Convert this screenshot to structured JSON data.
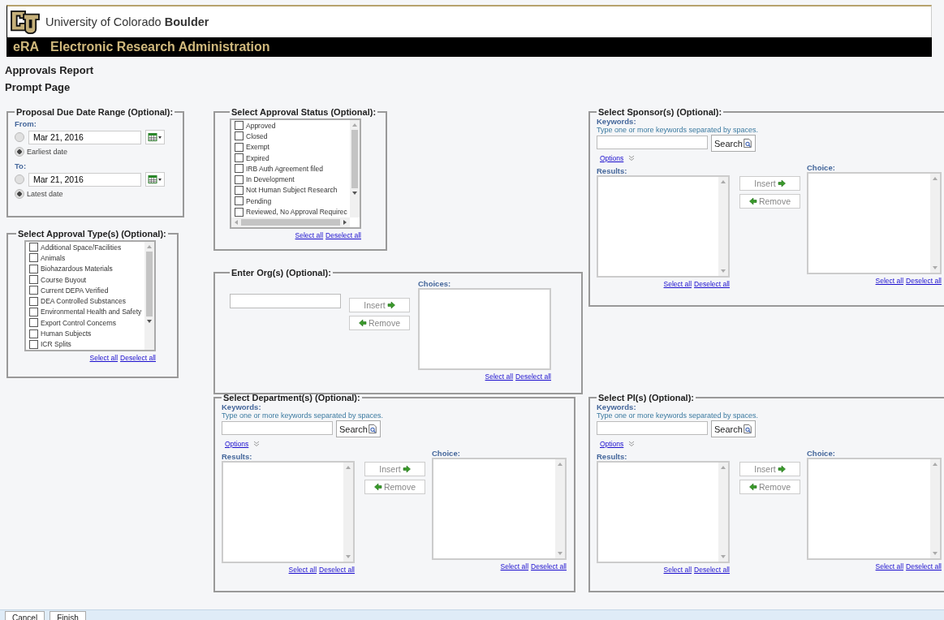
{
  "header": {
    "university": "University of Colorado **Boulder**",
    "app_abbrev": "eRA",
    "app_name": "Electronic Research Administration"
  },
  "page_titles": [
    "Approvals Report",
    "Prompt Page"
  ],
  "date_range": {
    "title": "Proposal Due Date Range (Optional):",
    "groups": [
      {
        "label": "From:",
        "options": [
          {
            "kind": "date",
            "value": "Mar 21, 2016",
            "selected": false
          },
          {
            "kind": "label",
            "label": "Earliest date",
            "selected": true
          }
        ]
      },
      {
        "label": "To:",
        "options": [
          {
            "kind": "date",
            "value": "Mar 21, 2016",
            "selected": false
          },
          {
            "kind": "label",
            "label": "Latest date",
            "selected": true
          }
        ]
      }
    ]
  },
  "approval_types": {
    "title": "Select Approval Type(s) (Optional):",
    "items": [
      {
        "label": "Additional Space/Facilities",
        "checked": false
      },
      {
        "label": "Animals",
        "checked": false
      },
      {
        "label": "Biohazardous Materials",
        "checked": false
      },
      {
        "label": "Course Buyout",
        "checked": false
      },
      {
        "label": "Current DEPA Verified",
        "checked": false
      },
      {
        "label": "DEA Controlled Substances",
        "checked": false
      },
      {
        "label": "Environmental Health and Safety",
        "checked": false
      },
      {
        "label": "Export Control Concerns",
        "checked": false
      },
      {
        "label": "Human Subjects",
        "checked": false
      },
      {
        "label": "ICR Splits",
        "checked": false
      }
    ],
    "select_all": "Select all",
    "deselect_all": "Deselect all"
  },
  "approval_status": {
    "title": "Select Approval Status (Optional):",
    "items": [
      {
        "label": "Approved",
        "checked": false
      },
      {
        "label": "Closed",
        "checked": false
      },
      {
        "label": "Exempt",
        "checked": false
      },
      {
        "label": "Expired",
        "checked": false
      },
      {
        "label": "IRB Auth Agreement filed",
        "checked": false
      },
      {
        "label": "In Development",
        "checked": false
      },
      {
        "label": "Not Human Subject Research",
        "checked": false
      },
      {
        "label": "Pending",
        "checked": false
      },
      {
        "label": "Reviewed, No Approval Requirec",
        "checked": false
      }
    ],
    "select_all": "Select all",
    "deselect_all": "Deselect all"
  },
  "orgs": {
    "title": "Enter Org(s) (Optional):",
    "choices_label": "Choices:",
    "insert": "Insert",
    "remove": "Remove",
    "select_all": "Select all",
    "deselect_all": "Deselect all"
  },
  "sponsors": {
    "title": "Select Sponsor(s) (Optional):",
    "keywords_label": "Keywords:",
    "hint": "Type one or more keywords separated by spaces.",
    "search": "Search",
    "options": "Options",
    "results_label": "Results:",
    "choice_label": "Choice:",
    "insert": "Insert",
    "remove": "Remove",
    "results_select_all": "Select all",
    "results_deselect_all": "Deselect all",
    "choice_select_all": "Select all",
    "choice_deselect_all": "Deselect all"
  },
  "departments": {
    "title": "Select Department(s) (Optional):",
    "keywords_label": "Keywords:",
    "hint": "Type one or more keywords separated by spaces.",
    "search": "Search",
    "options": "Options",
    "results_label": "Results:",
    "choice_label": "Choice:",
    "insert": "Insert",
    "remove": "Remove",
    "results_select_all": "Select all",
    "results_deselect_all": "Deselect all",
    "choice_select_all": "Select all",
    "choice_deselect_all": "Deselect all"
  },
  "pis": {
    "title": "Select PI(s) (Optional):",
    "keywords_label": "Keywords:",
    "hint": "Type one or more keywords separated by spaces.",
    "search": "Search",
    "options": "Options",
    "results_label": "Results:",
    "choice_label": "Choice:",
    "insert": "Insert",
    "remove": "Remove",
    "results_select_all": "Select all",
    "results_deselect_all": "Deselect all",
    "choice_select_all": "Select all",
    "choice_deselect_all": "Deselect all"
  },
  "footer_buttons": [
    "Cancel",
    "Finish"
  ]
}
